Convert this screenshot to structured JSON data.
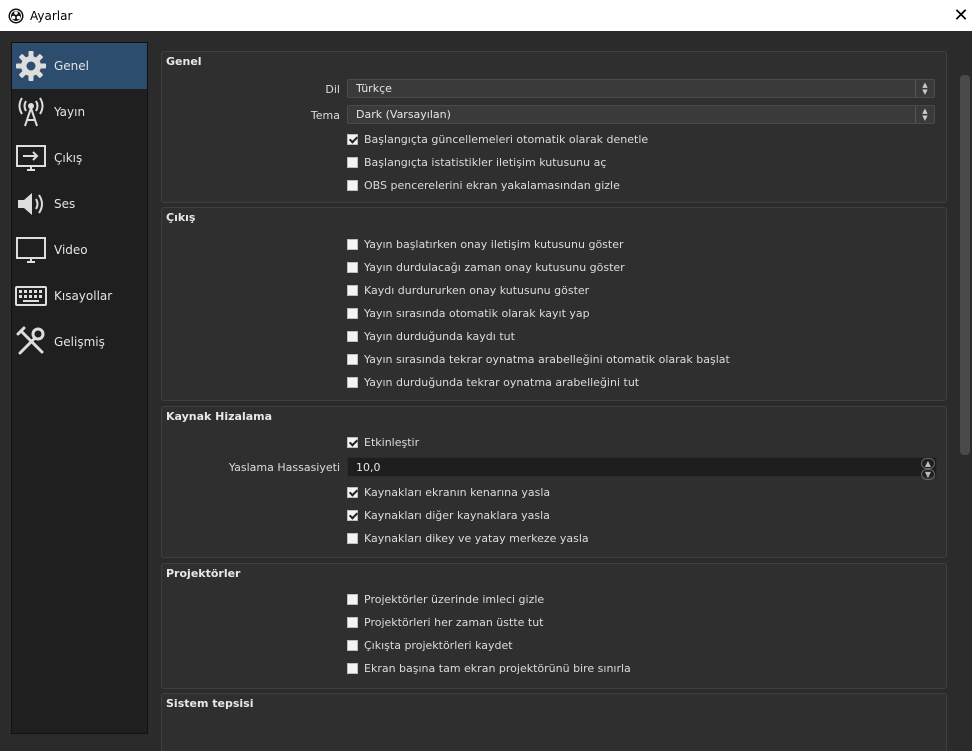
{
  "window": {
    "title": "Ayarlar"
  },
  "sidebar": {
    "items": [
      {
        "label": "Genel",
        "icon": "gear-icon",
        "active": true
      },
      {
        "label": "Yayın",
        "icon": "broadcast-antenna-icon",
        "active": false
      },
      {
        "label": "Çıkış",
        "icon": "output-monitor-icon",
        "active": false
      },
      {
        "label": "Ses",
        "icon": "speaker-icon",
        "active": false
      },
      {
        "label": "Video",
        "icon": "monitor-icon",
        "active": false
      },
      {
        "label": "Kısayollar",
        "icon": "keyboard-icon",
        "active": false
      },
      {
        "label": "Gelişmiş",
        "icon": "tools-icon",
        "active": false
      }
    ]
  },
  "general": {
    "title": "Genel",
    "language_label": "Dil",
    "language_value": "Türkçe",
    "theme_label": "Tema",
    "theme_value": "Dark (Varsayılan)",
    "checks": [
      {
        "label": "Başlangıçta güncellemeleri otomatik olarak denetle",
        "checked": true
      },
      {
        "label": "Başlangıçta istatistikler iletişim kutusunu aç",
        "checked": false
      },
      {
        "label": "OBS pencerelerini ekran yakalamasından gizle",
        "checked": false
      }
    ]
  },
  "output": {
    "title": "Çıkış",
    "checks": [
      {
        "label": "Yayın başlatırken onay iletişim kutusunu göster",
        "checked": false
      },
      {
        "label": "Yayın durdulacağı zaman onay kutusunu göster",
        "checked": false
      },
      {
        "label": "Kaydı durdururken onay kutusunu göster",
        "checked": false
      },
      {
        "label": "Yayın sırasında otomatik olarak kayıt yap",
        "checked": false
      },
      {
        "label": "Yayın durduğunda kaydı tut",
        "checked": false
      },
      {
        "label": "Yayın sırasında tekrar oynatma arabelleğini otomatik olarak başlat",
        "checked": false
      },
      {
        "label": "Yayın durduğunda tekrar oynatma arabelleğini tut",
        "checked": false
      }
    ]
  },
  "snapping": {
    "title": "Kaynak Hizalama",
    "enable_label": "Etkinleştir",
    "enable_checked": true,
    "sensitivity_label": "Yaslama Hassasiyeti",
    "sensitivity_value": "10,0",
    "checks": [
      {
        "label": "Kaynakları ekranın kenarına yasla",
        "checked": true
      },
      {
        "label": "Kaynakları diğer kaynaklara yasla",
        "checked": true
      },
      {
        "label": "Kaynakları dikey ve yatay merkeze yasla",
        "checked": false
      }
    ]
  },
  "projectors": {
    "title": "Projektörler",
    "checks": [
      {
        "label": "Projektörler üzerinde imleci gizle",
        "checked": false
      },
      {
        "label": "Projektörleri her zaman üstte tut",
        "checked": false
      },
      {
        "label": "Çıkışta projektörleri kaydet",
        "checked": false
      },
      {
        "label": "Ekran başına tam ekran projektörünü bire sınırla",
        "checked": false
      }
    ]
  },
  "tray": {
    "title": "Sistem tepsisi"
  },
  "colors": {
    "accent": "#2c4d6e",
    "background": "#2b2b2b",
    "sidebar": "#1f1f1f"
  }
}
